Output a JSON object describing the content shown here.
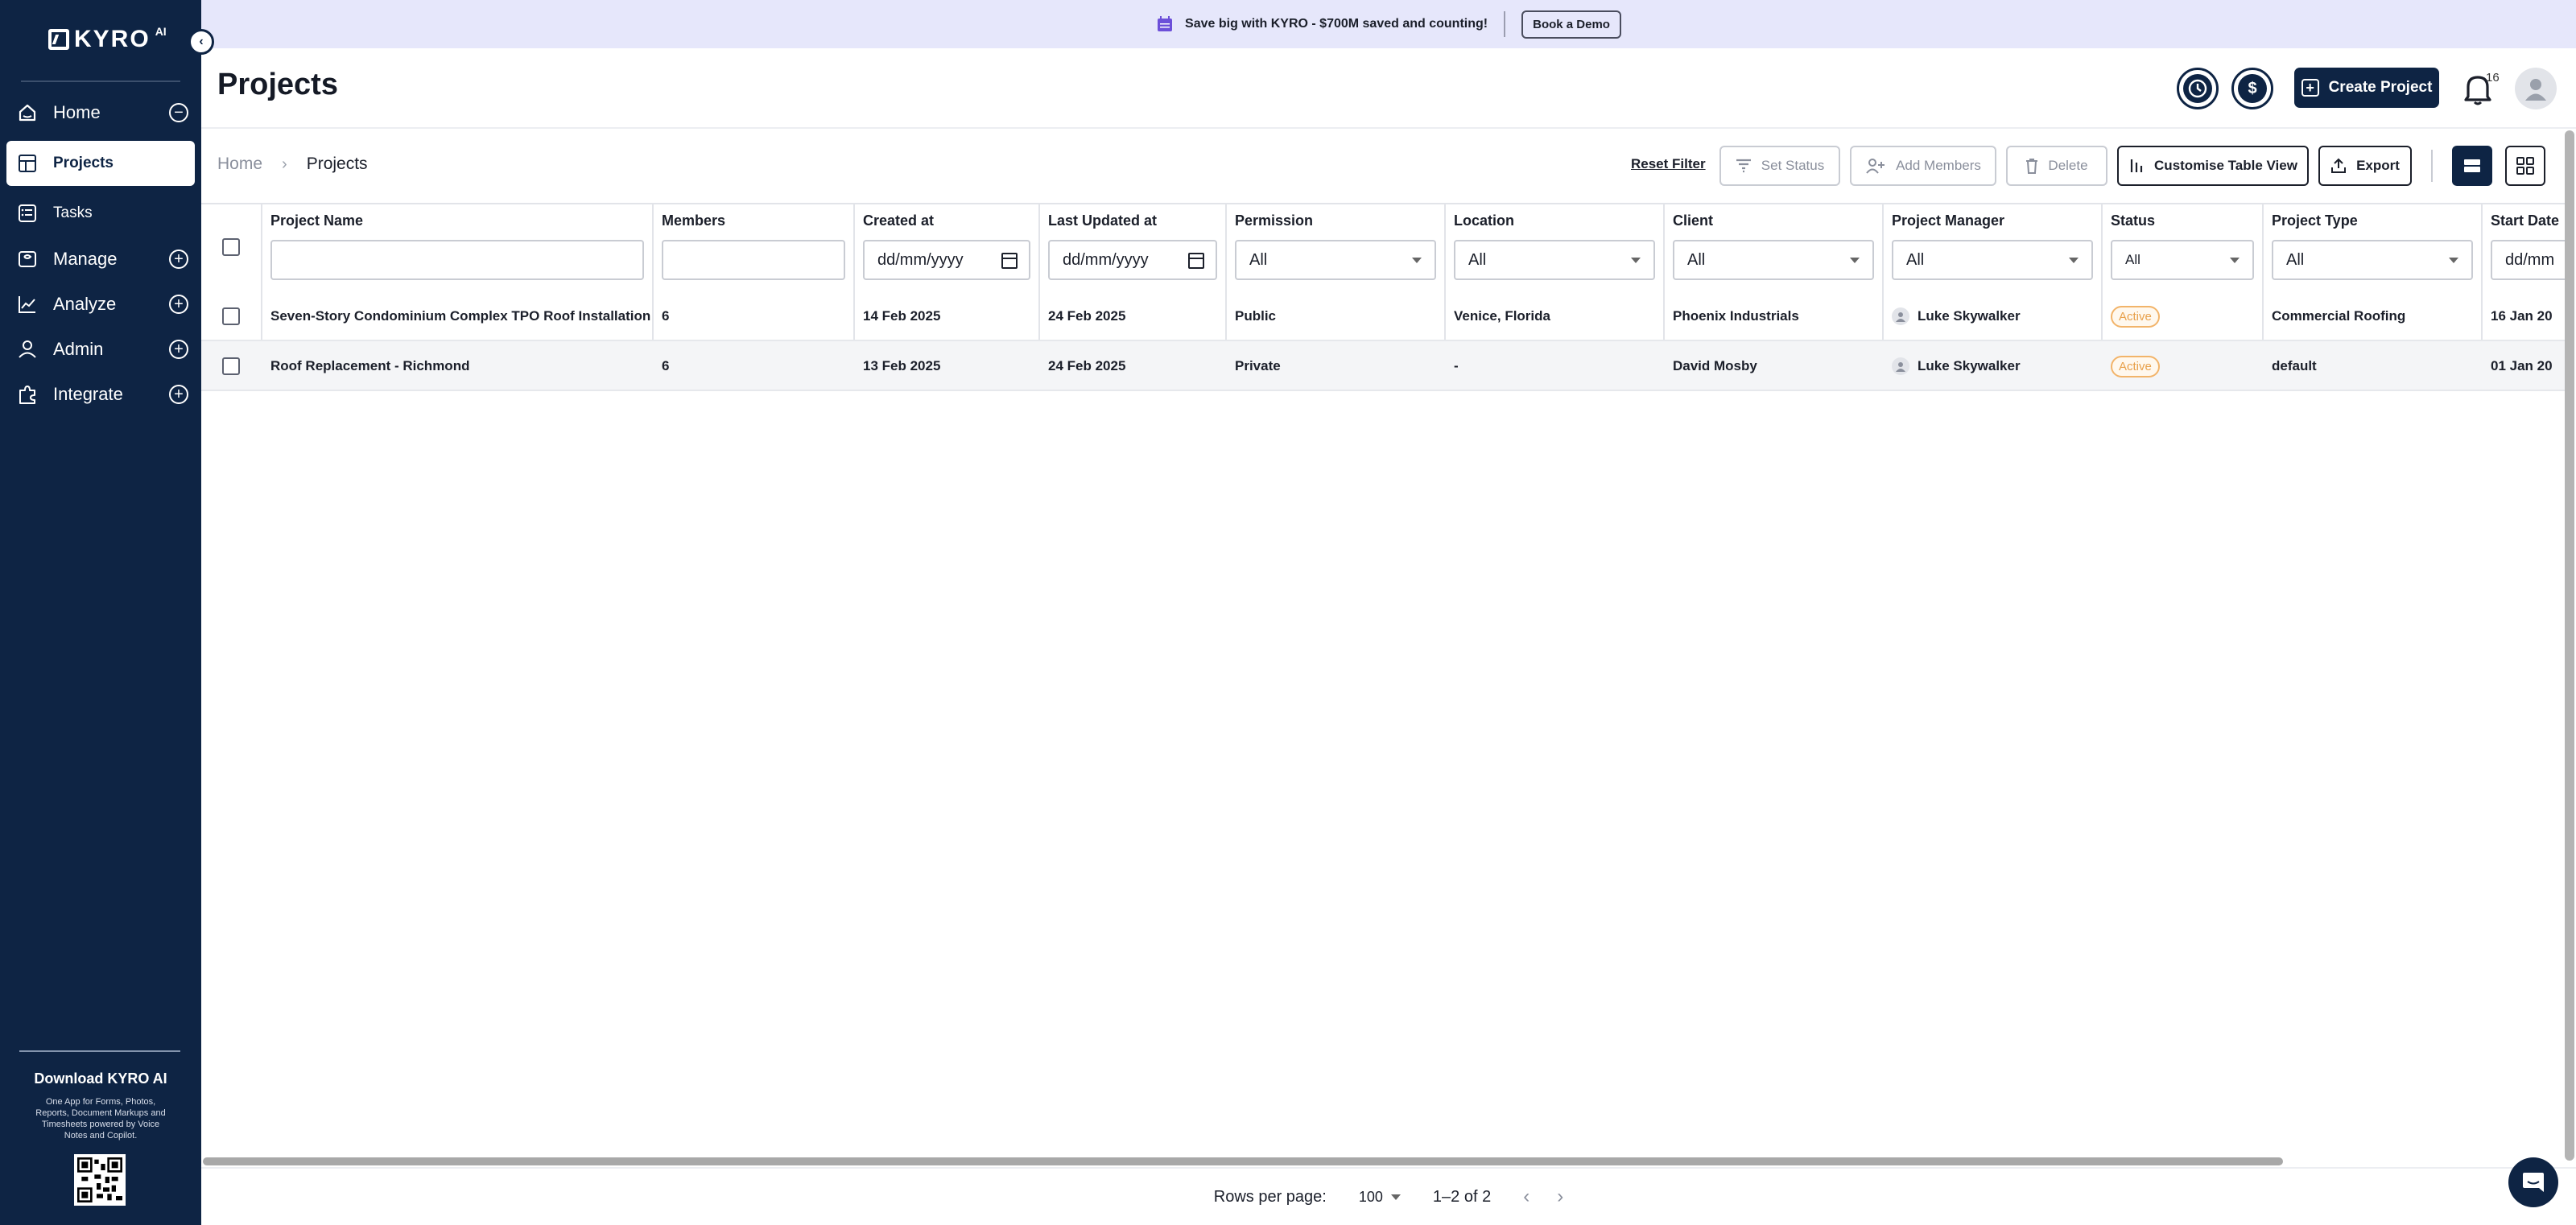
{
  "sidebar": {
    "logo_text": "KYRO",
    "logo_suffix": "AI",
    "items": [
      {
        "label": "Home",
        "icon": "home-icon",
        "expandable": true
      },
      {
        "label": "Projects",
        "icon": "table-icon",
        "active": true
      },
      {
        "label": "Tasks",
        "icon": "tasks-icon"
      },
      {
        "label": "Manage",
        "icon": "manage-icon",
        "expandable": true
      },
      {
        "label": "Analyze",
        "icon": "chart-icon",
        "expandable": true
      },
      {
        "label": "Admin",
        "icon": "user-icon",
        "expandable": true
      },
      {
        "label": "Integrate",
        "icon": "puzzle-icon",
        "expandable": true
      }
    ],
    "download_title": "Download KYRO AI",
    "download_desc": "One App for Forms, Photos, Reports, Document Markups and Timesheets powered by Voice Notes and Copilot."
  },
  "banner": {
    "text": "Save big with KYRO - $700M saved and counting!",
    "button": "Book a Demo"
  },
  "header": {
    "title": "Projects",
    "create_button": "Create Project",
    "notification_count": "16"
  },
  "toolbar": {
    "breadcrumb_home": "Home",
    "breadcrumb_current": "Projects",
    "reset_filter": "Reset Filter",
    "set_status": "Set Status",
    "add_members": "Add Members",
    "delete": "Delete",
    "customise": "Customise Table View",
    "export": "Export"
  },
  "table": {
    "columns": [
      "Project Name",
      "Members",
      "Created at",
      "Last Updated at",
      "Permission",
      "Location",
      "Client",
      "Project Manager",
      "Status",
      "Project Type",
      "Start Date"
    ],
    "filters": {
      "date_placeholder": "dd/mm/yyyy",
      "select_all": "All",
      "start_date_partial": "dd/mm"
    },
    "rows": [
      {
        "name": "Seven-Story Condominium Complex TPO Roof Installation",
        "members": "6",
        "created": "14 Feb 2025",
        "updated": "24 Feb 2025",
        "permission": "Public",
        "location": "Venice, Florida",
        "client": "Phoenix Industrials",
        "manager": "Luke Skywalker",
        "status": "Active",
        "type": "Commercial Roofing",
        "start": "16 Jan 20"
      },
      {
        "name": "Roof Replacement - Richmond",
        "members": "6",
        "created": "13 Feb 2025",
        "updated": "24 Feb 2025",
        "permission": "Private",
        "location": "-",
        "client": "David Mosby",
        "manager": "Luke Skywalker",
        "status": "Active",
        "type": "default",
        "start": "01 Jan 20"
      }
    ]
  },
  "pagination": {
    "rows_per_page_label": "Rows per page:",
    "rows_per_page": "100",
    "range": "1–2 of 2"
  },
  "colors": {
    "sidebar": "#0e2444",
    "banner": "#e6e7fb",
    "status_active": "#e8a04a"
  }
}
